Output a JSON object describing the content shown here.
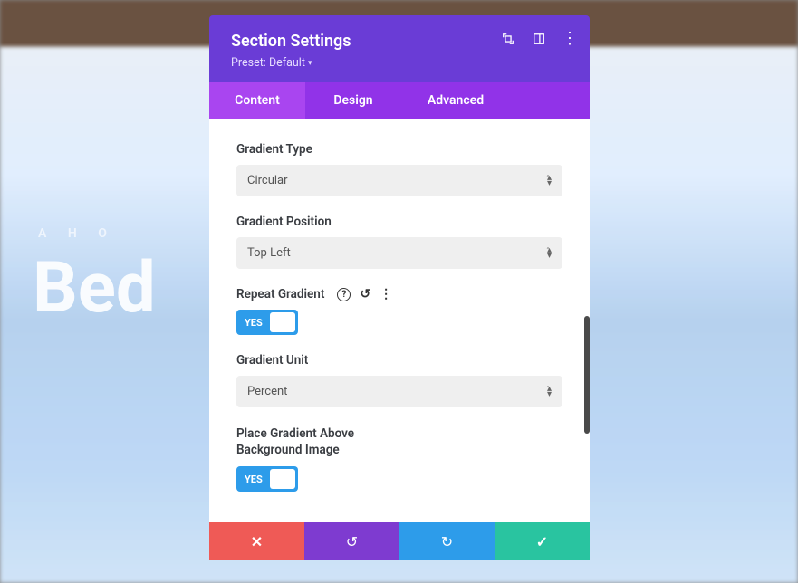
{
  "header": {
    "title": "Section Settings",
    "preset_prefix": "Preset: ",
    "preset_value": "Default"
  },
  "tabs": {
    "content": "Content",
    "design": "Design",
    "advanced": "Advanced"
  },
  "fields": {
    "gradient_type": {
      "label": "Gradient Type",
      "value": "Circular"
    },
    "gradient_position": {
      "label": "Gradient Position",
      "value": "Top Left"
    },
    "repeat_gradient": {
      "label": "Repeat Gradient",
      "value": "YES"
    },
    "gradient_unit": {
      "label": "Gradient Unit",
      "value": "Percent"
    },
    "place_above": {
      "label": "Place Gradient Above Background Image",
      "value": "YES"
    }
  },
  "hero": {
    "tagline": "A  H O",
    "big": "Bed"
  }
}
